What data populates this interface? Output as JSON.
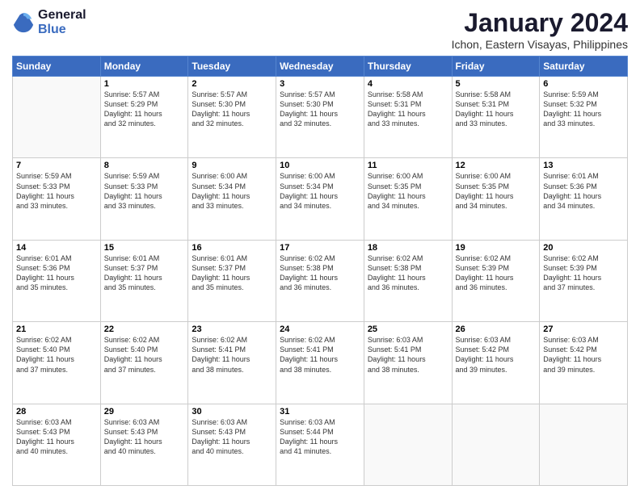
{
  "logo": {
    "line1": "General",
    "line2": "Blue"
  },
  "title": "January 2024",
  "subtitle": "Ichon, Eastern Visayas, Philippines",
  "days": [
    "Sunday",
    "Monday",
    "Tuesday",
    "Wednesday",
    "Thursday",
    "Friday",
    "Saturday"
  ],
  "weeks": [
    [
      {
        "date": "",
        "info": ""
      },
      {
        "date": "1",
        "info": "Sunrise: 5:57 AM\nSunset: 5:29 PM\nDaylight: 11 hours\nand 32 minutes."
      },
      {
        "date": "2",
        "info": "Sunrise: 5:57 AM\nSunset: 5:30 PM\nDaylight: 11 hours\nand 32 minutes."
      },
      {
        "date": "3",
        "info": "Sunrise: 5:57 AM\nSunset: 5:30 PM\nDaylight: 11 hours\nand 32 minutes."
      },
      {
        "date": "4",
        "info": "Sunrise: 5:58 AM\nSunset: 5:31 PM\nDaylight: 11 hours\nand 33 minutes."
      },
      {
        "date": "5",
        "info": "Sunrise: 5:58 AM\nSunset: 5:31 PM\nDaylight: 11 hours\nand 33 minutes."
      },
      {
        "date": "6",
        "info": "Sunrise: 5:59 AM\nSunset: 5:32 PM\nDaylight: 11 hours\nand 33 minutes."
      }
    ],
    [
      {
        "date": "7",
        "info": "Sunrise: 5:59 AM\nSunset: 5:33 PM\nDaylight: 11 hours\nand 33 minutes."
      },
      {
        "date": "8",
        "info": "Sunrise: 5:59 AM\nSunset: 5:33 PM\nDaylight: 11 hours\nand 33 minutes."
      },
      {
        "date": "9",
        "info": "Sunrise: 6:00 AM\nSunset: 5:34 PM\nDaylight: 11 hours\nand 33 minutes."
      },
      {
        "date": "10",
        "info": "Sunrise: 6:00 AM\nSunset: 5:34 PM\nDaylight: 11 hours\nand 34 minutes."
      },
      {
        "date": "11",
        "info": "Sunrise: 6:00 AM\nSunset: 5:35 PM\nDaylight: 11 hours\nand 34 minutes."
      },
      {
        "date": "12",
        "info": "Sunrise: 6:00 AM\nSunset: 5:35 PM\nDaylight: 11 hours\nand 34 minutes."
      },
      {
        "date": "13",
        "info": "Sunrise: 6:01 AM\nSunset: 5:36 PM\nDaylight: 11 hours\nand 34 minutes."
      }
    ],
    [
      {
        "date": "14",
        "info": "Sunrise: 6:01 AM\nSunset: 5:36 PM\nDaylight: 11 hours\nand 35 minutes."
      },
      {
        "date": "15",
        "info": "Sunrise: 6:01 AM\nSunset: 5:37 PM\nDaylight: 11 hours\nand 35 minutes."
      },
      {
        "date": "16",
        "info": "Sunrise: 6:01 AM\nSunset: 5:37 PM\nDaylight: 11 hours\nand 35 minutes."
      },
      {
        "date": "17",
        "info": "Sunrise: 6:02 AM\nSunset: 5:38 PM\nDaylight: 11 hours\nand 36 minutes."
      },
      {
        "date": "18",
        "info": "Sunrise: 6:02 AM\nSunset: 5:38 PM\nDaylight: 11 hours\nand 36 minutes."
      },
      {
        "date": "19",
        "info": "Sunrise: 6:02 AM\nSunset: 5:39 PM\nDaylight: 11 hours\nand 36 minutes."
      },
      {
        "date": "20",
        "info": "Sunrise: 6:02 AM\nSunset: 5:39 PM\nDaylight: 11 hours\nand 37 minutes."
      }
    ],
    [
      {
        "date": "21",
        "info": "Sunrise: 6:02 AM\nSunset: 5:40 PM\nDaylight: 11 hours\nand 37 minutes."
      },
      {
        "date": "22",
        "info": "Sunrise: 6:02 AM\nSunset: 5:40 PM\nDaylight: 11 hours\nand 37 minutes."
      },
      {
        "date": "23",
        "info": "Sunrise: 6:02 AM\nSunset: 5:41 PM\nDaylight: 11 hours\nand 38 minutes."
      },
      {
        "date": "24",
        "info": "Sunrise: 6:02 AM\nSunset: 5:41 PM\nDaylight: 11 hours\nand 38 minutes."
      },
      {
        "date": "25",
        "info": "Sunrise: 6:03 AM\nSunset: 5:41 PM\nDaylight: 11 hours\nand 38 minutes."
      },
      {
        "date": "26",
        "info": "Sunrise: 6:03 AM\nSunset: 5:42 PM\nDaylight: 11 hours\nand 39 minutes."
      },
      {
        "date": "27",
        "info": "Sunrise: 6:03 AM\nSunset: 5:42 PM\nDaylight: 11 hours\nand 39 minutes."
      }
    ],
    [
      {
        "date": "28",
        "info": "Sunrise: 6:03 AM\nSunset: 5:43 PM\nDaylight: 11 hours\nand 40 minutes."
      },
      {
        "date": "29",
        "info": "Sunrise: 6:03 AM\nSunset: 5:43 PM\nDaylight: 11 hours\nand 40 minutes."
      },
      {
        "date": "30",
        "info": "Sunrise: 6:03 AM\nSunset: 5:43 PM\nDaylight: 11 hours\nand 40 minutes."
      },
      {
        "date": "31",
        "info": "Sunrise: 6:03 AM\nSunset: 5:44 PM\nDaylight: 11 hours\nand 41 minutes."
      },
      {
        "date": "",
        "info": ""
      },
      {
        "date": "",
        "info": ""
      },
      {
        "date": "",
        "info": ""
      }
    ]
  ]
}
